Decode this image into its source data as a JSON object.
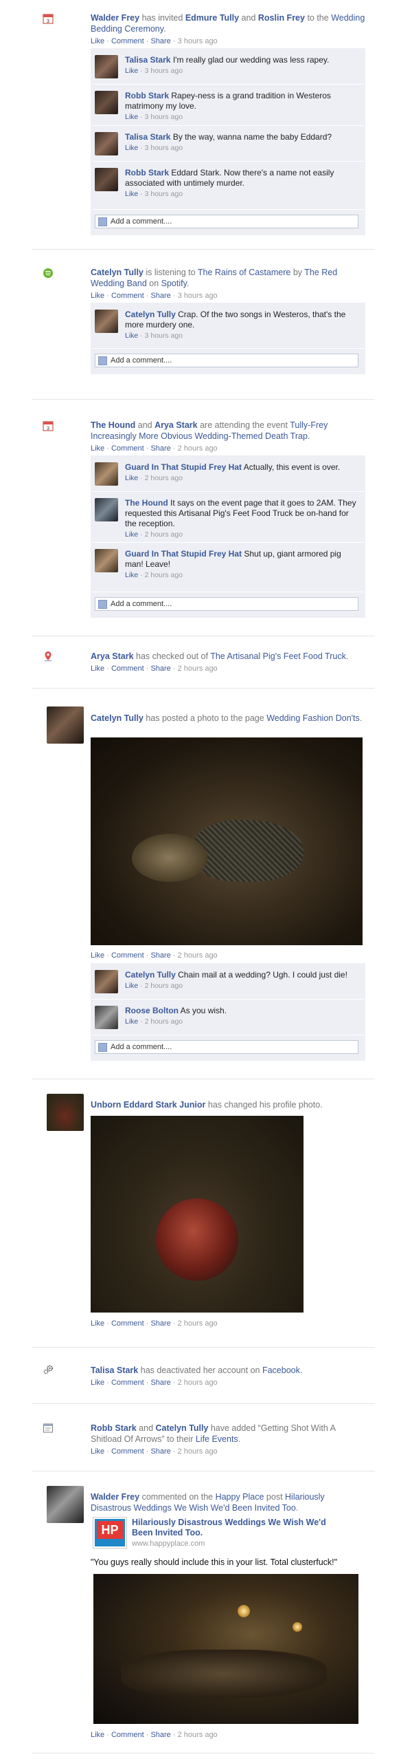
{
  "stories": {
    "s1": {
      "actor": "Walder Frey",
      "verb": " has invited ",
      "target1": "Edmure Tully",
      "and": " and ",
      "target2": "Roslin Frey",
      "to": " to the ",
      "event": "Wedding Bedding Ceremony",
      "period": ".",
      "time": "3 hours ago",
      "comments": [
        {
          "name": "Talisa Stark",
          "text": " I'm really glad our wedding was less rapey.",
          "time": "3 hours ago"
        },
        {
          "name": "Robb Stark",
          "text": " Rapey-ness is a grand tradition in Westeros matrimony my love.",
          "time": "3 hours ago"
        },
        {
          "name": "Talisa Stark",
          "text": " By the way, wanna name the baby Eddard?",
          "time": "3 hours ago"
        },
        {
          "name": "Robb Stark",
          "text": " Eddard Stark. Now there's a name not easily associated with untimely murder.",
          "time": "3 hours ago"
        }
      ]
    },
    "s2": {
      "actor": "Catelyn Tully",
      "verb": " is listening to ",
      "song": "The Rains of Castamere",
      "by": " by ",
      "artist": "The Red Wedding Band",
      "on": " on ",
      "app": "Spotify",
      "period": ".",
      "time": "3 hours ago",
      "comments": [
        {
          "name": "Catelyn Tully",
          "text": " Crap. Of the two songs in Westeros, that's the more murdery one.",
          "time": "3 hours ago"
        }
      ]
    },
    "s3": {
      "actor1": "The Hound",
      "and": " and ",
      "actor2": "Arya Stark",
      "verb": " are attending the event ",
      "event": "Tully-Frey Increasingly More Obvious Wedding-Themed Death Trap",
      "period": ".",
      "time": "2 hours ago",
      "comments": [
        {
          "name": "Guard In That Stupid Frey Hat",
          "text": " Actually, this event is over.",
          "time": "2 hours ago"
        },
        {
          "name": "The Hound",
          "text": " It says on the event page that it goes to 2AM. They requested this Artisanal Pig's Feet Food Truck be on-hand for the reception.",
          "time": "2 hours ago"
        },
        {
          "name": "Guard In That Stupid Frey Hat",
          "text": " Shut up, giant armored pig man! Leave!",
          "time": "2 hours ago"
        }
      ]
    },
    "s4": {
      "actor": "Arya Stark",
      "verb": " has checked out of ",
      "place": "The Artisanal Pig's Feet Food Truck",
      "period": ".",
      "time": "2 hours ago"
    },
    "s5": {
      "actor": "Catelyn Tully",
      "verb": " has posted a photo to the page ",
      "page": "Wedding Fashion Don'ts",
      "period": ".",
      "time": "2 hours ago",
      "comments": [
        {
          "name": "Catelyn Tully",
          "text": " Chain mail at a wedding? Ugh. I could just die!",
          "time": "2 hours ago"
        },
        {
          "name": "Roose Bolton",
          "text": " As you wish.",
          "time": "2 hours ago"
        }
      ]
    },
    "s6": {
      "actor": "Unborn Eddard Stark Junior",
      "verb": " has changed his profile photo.",
      "time": "2 hours ago"
    },
    "s7": {
      "actor": "Talisa Stark",
      "verb": " has deactivated her account on ",
      "site": "Facebook",
      "period": ".",
      "time": "2 hours ago"
    },
    "s8": {
      "actor1": "Robb Stark",
      "and": " and ",
      "actor2": "Catelyn Tully",
      "verb": " have added “Getting Shot With A Shitload Of Arrows” to their ",
      "target": "Life Events",
      "period": ".",
      "time": "2 hours ago"
    },
    "s9": {
      "actor": "Walder Frey",
      "verb": " commented on the ",
      "page": "Happy Place",
      "post": " post ",
      "post_title": "Hilariously Disastrous Weddings We Wish We'd Been Invited Too",
      "period": ".",
      "link_title": "Hilariously Disastrous Weddings We Wish We'd Been Invited Too.",
      "link_url": "www.happyplace.com",
      "logo_text": "HP",
      "quote": "\"You guys really should include this in your list. Total clusterfuck!\"",
      "time": "2 hours ago"
    }
  },
  "actions": {
    "like": "Like",
    "comment": "Comment",
    "share": "Share",
    "dot": " · ",
    "add_comment": "Add a comment...."
  },
  "icons": {
    "event": "calendar-icon",
    "music": "spotify-icon",
    "place": "map-pin-icon",
    "gear": "gear-icon",
    "life": "life-event-icon",
    "comment_box": "comment-box-icon"
  },
  "colors": {
    "link": "#3b5998",
    "comment_bg": "#edeff4"
  }
}
